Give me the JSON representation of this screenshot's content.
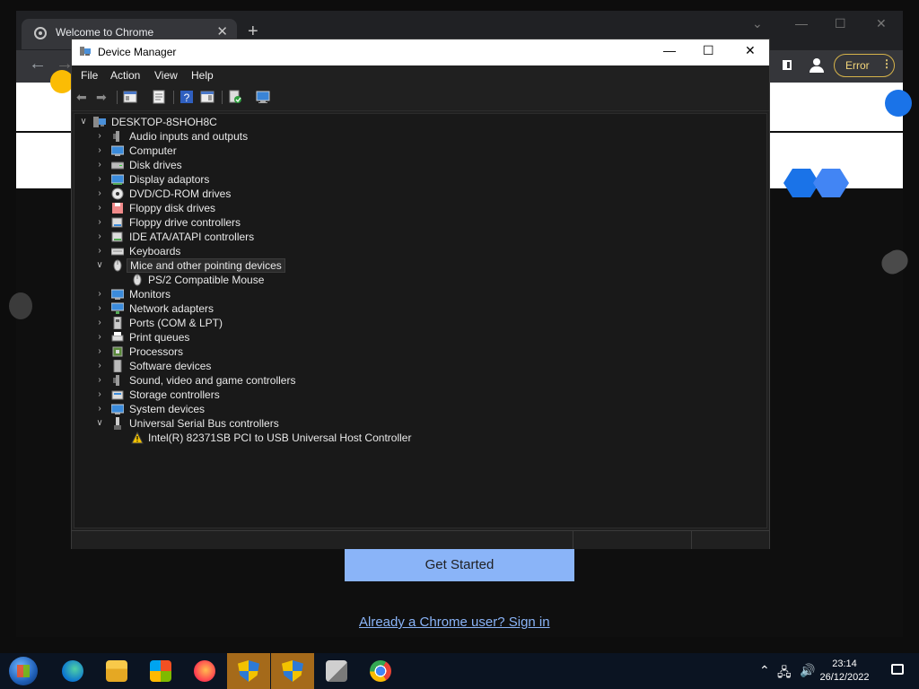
{
  "chrome": {
    "tab_title": "Welcome to Chrome",
    "error_label": "Error",
    "get_started": "Get Started",
    "signin_link": "Already a Chrome user? Sign in"
  },
  "devmgr": {
    "title": "Device Manager",
    "menu": [
      "File",
      "Action",
      "View",
      "Help"
    ],
    "root": "DESKTOP-8SHOH8C",
    "tree": [
      {
        "label": "Audio inputs and outputs",
        "icon": "speaker-icon",
        "expanded": false
      },
      {
        "label": "Computer",
        "icon": "computer-icon",
        "expanded": false
      },
      {
        "label": "Disk drives",
        "icon": "disk-drive-icon",
        "expanded": false
      },
      {
        "label": "Display adaptors",
        "icon": "display-adaptor-icon",
        "expanded": false
      },
      {
        "label": "DVD/CD-ROM drives",
        "icon": "dvd-icon",
        "expanded": false
      },
      {
        "label": "Floppy disk drives",
        "icon": "floppy-icon",
        "expanded": false
      },
      {
        "label": "Floppy drive controllers",
        "icon": "controller-icon",
        "expanded": false
      },
      {
        "label": "IDE ATA/ATAPI controllers",
        "icon": "ide-controller-icon",
        "expanded": false
      },
      {
        "label": "Keyboards",
        "icon": "keyboard-icon",
        "expanded": false
      },
      {
        "label": "Mice and other pointing devices",
        "icon": "mouse-icon",
        "expanded": true,
        "selected": true,
        "children": [
          {
            "label": "PS/2 Compatible Mouse",
            "icon": "mouse-icon"
          }
        ]
      },
      {
        "label": "Monitors",
        "icon": "monitor-icon",
        "expanded": false
      },
      {
        "label": "Network adapters",
        "icon": "network-adapter-icon",
        "expanded": false
      },
      {
        "label": "Ports (COM & LPT)",
        "icon": "port-icon",
        "expanded": false
      },
      {
        "label": "Print queues",
        "icon": "printer-icon",
        "expanded": false
      },
      {
        "label": "Processors",
        "icon": "processor-icon",
        "expanded": false
      },
      {
        "label": "Software devices",
        "icon": "software-device-icon",
        "expanded": false
      },
      {
        "label": "Sound, video and game controllers",
        "icon": "speaker-icon",
        "expanded": false
      },
      {
        "label": "Storage controllers",
        "icon": "storage-controller-icon",
        "expanded": false
      },
      {
        "label": "System devices",
        "icon": "system-device-icon",
        "expanded": false
      },
      {
        "label": "Universal Serial Bus controllers",
        "icon": "usb-icon",
        "expanded": true,
        "children": [
          {
            "label": "Intel(R) 82371SB PCI to USB Universal Host Controller",
            "icon": "warning-icon"
          }
        ]
      }
    ]
  },
  "taskbar": {
    "apps": [
      "edge-icon",
      "file-explorer-icon",
      "store-icon",
      "firefox-icon",
      "shield-app-icon",
      "shield-app-icon",
      "device-manager-icon",
      "chrome-icon"
    ],
    "time": "23:14",
    "date": "26/12/2022"
  },
  "colors": {
    "accent_blue": "#8ab4f8",
    "error_yellow": "#f3d67a",
    "active_taskbar": "#a56a1a"
  }
}
